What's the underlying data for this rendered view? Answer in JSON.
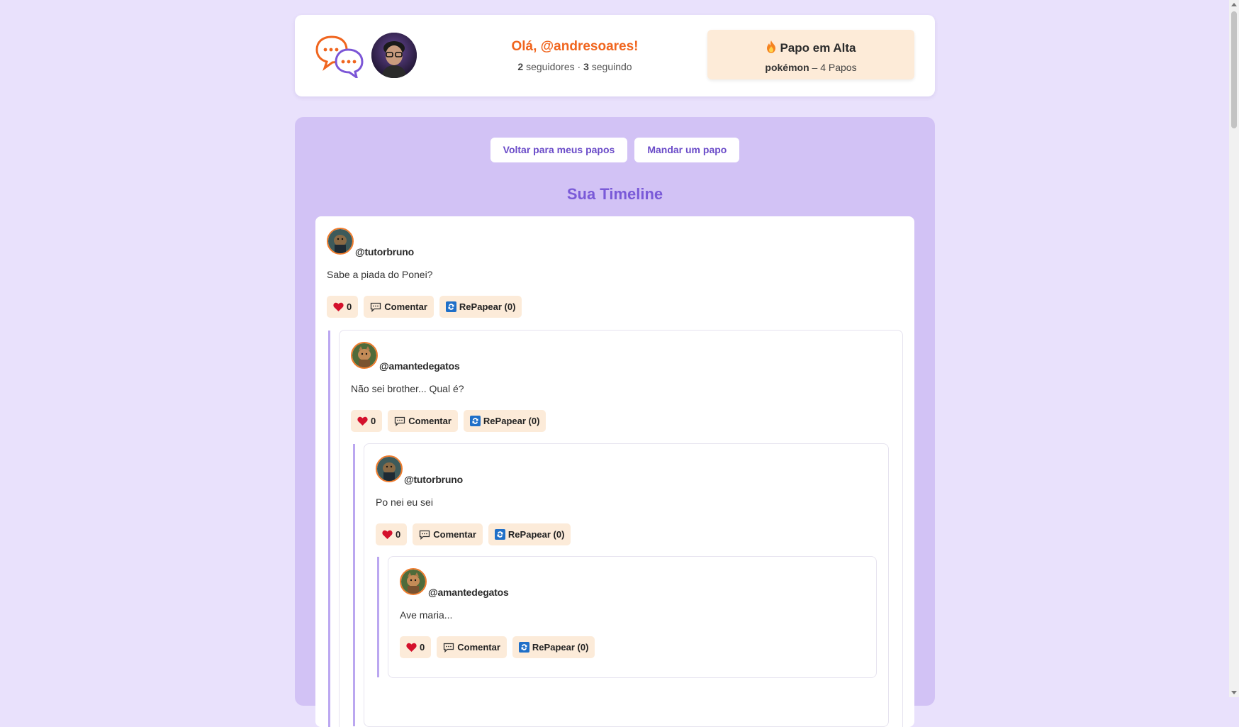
{
  "header": {
    "greeting": "Olá, @andresoares!",
    "followers_count": "2",
    "followers_label": "seguidores",
    "separator": "·",
    "following_count": "3",
    "following_label": "seguindo",
    "trending": {
      "icon": "fire-icon",
      "title": "Papo em Alta",
      "tag": "pokémon",
      "dash": "–",
      "count_text": "4 Papos"
    }
  },
  "nav": {
    "back_label": "Voltar para meus papos",
    "send_label": "Mandar um papo"
  },
  "timeline": {
    "title": "Sua Timeline",
    "posts": [
      {
        "user": "@tutorbruno",
        "text": "Sabe a piada do Ponei?",
        "likes": "0",
        "comment_label": "Comentar",
        "repost_label": "RePapear (0)"
      },
      {
        "user": "@amantedegatos",
        "text": "Não sei brother... Qual é?",
        "likes": "0",
        "comment_label": "Comentar",
        "repost_label": "RePapear (0)"
      },
      {
        "user": "@tutorbruno",
        "text": "Po nei eu sei",
        "likes": "0",
        "comment_label": "Comentar",
        "repost_label": "RePapear (0)"
      },
      {
        "user": "@amantedegatos",
        "text": "Ave maria...",
        "likes": "0",
        "comment_label": "Comentar",
        "repost_label": "RePapear (0)"
      }
    ]
  },
  "colors": {
    "page_bg": "#e9e1fc",
    "panel_bg": "#d2c2f5",
    "accent_orange": "#f0651e",
    "accent_purple": "#7a5ad8",
    "action_bg": "#fcebd9",
    "thread_line": "#bba7f0"
  }
}
